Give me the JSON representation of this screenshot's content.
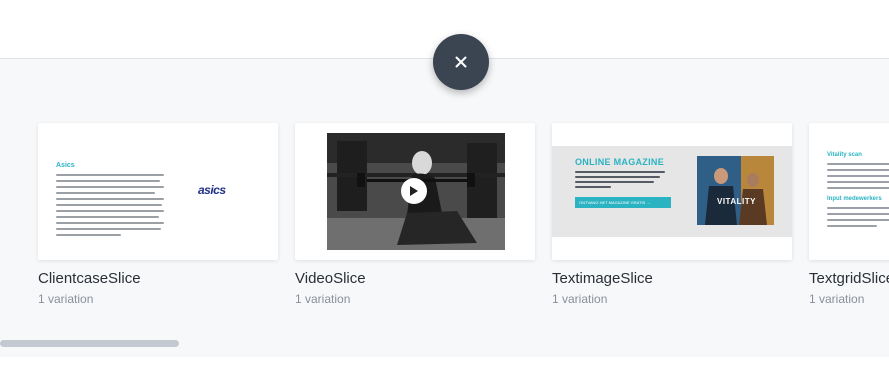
{
  "close_button": {
    "icon": "close-icon",
    "color": "#3b4552"
  },
  "slices": [
    {
      "title": "ClientcaseSlice",
      "variations": "1 variation",
      "preview": {
        "heading": "Asics",
        "logo": "asics"
      }
    },
    {
      "title": "VideoSlice",
      "variations": "1 variation",
      "preview": {
        "icon": "play-icon"
      }
    },
    {
      "title": "TextimageSlice",
      "variations": "1 variation",
      "preview": {
        "heading": "ONLINE MAGAZINE",
        "cta": "ONTVANG HET MAGAZINE GRATIS →",
        "image_text": "VITALITY"
      }
    },
    {
      "title": "TextgridSlice",
      "variations": "1 variation",
      "preview": {
        "heading_1": "Vitality scan",
        "heading_2": "Input medewerkers"
      }
    }
  ],
  "accent_color": "#2bb3c2"
}
